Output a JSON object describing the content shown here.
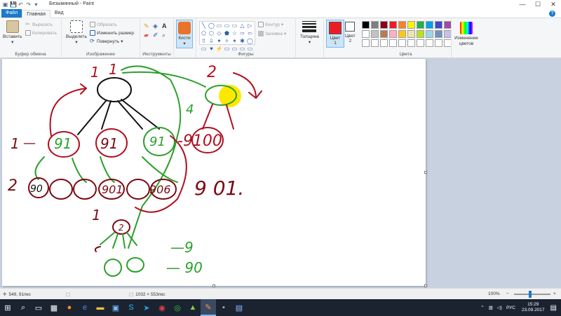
{
  "window": {
    "title": "Безымянный - Paint",
    "controls": [
      "—",
      "☐",
      "✕"
    ]
  },
  "tabs": {
    "file": "Файл",
    "home": "Главная",
    "view": "Вид"
  },
  "ribbon": {
    "clipboard": {
      "paste": "Вставить",
      "cut": "Вырезать",
      "copy": "Копировать",
      "label": "Буфер обмена"
    },
    "image": {
      "select": "Выделить",
      "crop": "Обрезать",
      "resize": "Изменить размер",
      "rotate": "Повернуть",
      "label": "Изображение"
    },
    "tools": {
      "label": "Инструменты"
    },
    "brushes": {
      "label": "Кисти"
    },
    "shapes": {
      "outline": "Контур",
      "fill": "Заливка",
      "label": "Фигуры",
      "glyphs": [
        "╲",
        "◯",
        "▭",
        "▭",
        "▭",
        "△",
        "▷",
        "⬠",
        "⬡",
        "◇",
        "⬟",
        "☆",
        "⇨",
        "⇦",
        "⇧",
        "⇩",
        "✦",
        "✧",
        "✶",
        "✱",
        "◯",
        "▭",
        "♥",
        "⚡",
        "▭",
        "▭",
        "▭",
        "▭"
      ]
    },
    "size": {
      "label": "Толщина"
    },
    "color1": {
      "label_line1": "Цвет",
      "label_line2": "1",
      "value": "#ed1c24"
    },
    "color2": {
      "label_line1": "Цвет",
      "label_line2": "2",
      "value": "#ffffff"
    },
    "colors": {
      "label": "Цвета",
      "edit": "Изменение цветов",
      "palette": [
        "#000000",
        "#7f7f7f",
        "#880015",
        "#ed1c24",
        "#ff7f27",
        "#fff200",
        "#22b14c",
        "#00a2e8",
        "#3f48cc",
        "#a349a4",
        "#ffffff",
        "#c3c3c3",
        "#b97a57",
        "#ffaec9",
        "#ffc90e",
        "#efe4b0",
        "#b5e61d",
        "#99d9ea",
        "#7092be",
        "#c8bfe7",
        "#ffffff",
        "#ffffff",
        "#ffffff",
        "#ffffff",
        "#ffffff",
        "#ffffff",
        "#ffffff",
        "#ffffff",
        "#ffffff",
        "#ffffff"
      ]
    }
  },
  "canvas": {
    "texts": {
      "t_1a": "1",
      "t_1b": "1",
      "t_2": "2",
      "t_4": "4",
      "t_1c": "1",
      "t_2b": "2",
      "t_dash_a": "—",
      "t_dash_b": "—",
      "t_91a": "91",
      "t_91b": "91",
      "t_91c": "91",
      "t_91d": "-9100",
      "t_90a": "90",
      "t_90b": "901",
      "t_90c": "906",
      "t_901": "9 01.",
      "t_1d": "1",
      "t_2c": "2",
      "t_9": "—9",
      "t_90": "— 90"
    }
  },
  "status": {
    "cursor": "549, 91пкс",
    "size": "1032 × 553пкс",
    "zoom": "100%"
  },
  "taskbar": {
    "time": "15:29",
    "date": "23.09.2017",
    "lang": "РУС"
  }
}
